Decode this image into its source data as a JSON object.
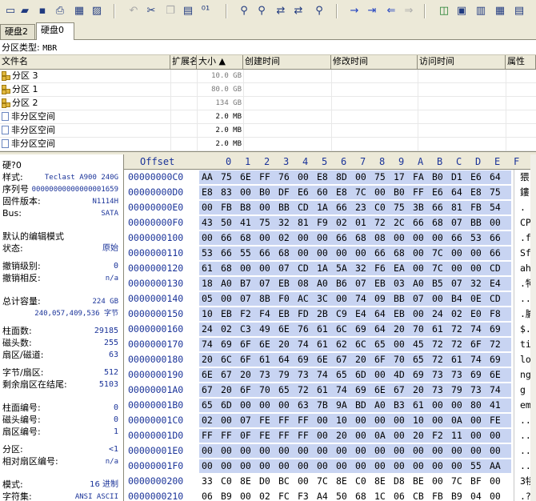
{
  "toolbar": {
    "icons": [
      "new-disk-icon",
      "open-folder-icon",
      "save-icon",
      "print-icon",
      "properties-icon",
      "open-image-icon",
      "undo-icon",
      "cut-icon",
      "copy-icon",
      "paste-icon",
      "binary-icon",
      "find-icon",
      "find-hex-icon",
      "replace-icon",
      "replace-hex-icon",
      "find-next-icon",
      "goto-icon",
      "goto-offset-icon",
      "back-icon",
      "forward-icon",
      "disk-icon",
      "windows-icon",
      "ram-icon",
      "calculator-icon",
      "settings-icon"
    ]
  },
  "tabs": [
    {
      "label": "硬盘2",
      "active": false
    },
    {
      "label": "硬盘0",
      "active": true
    }
  ],
  "partition_type": {
    "label": "分区类型:",
    "value": "MBR"
  },
  "columns": [
    {
      "label": "文件名"
    },
    {
      "label": "扩展名"
    },
    {
      "label": "大小 ▲"
    },
    {
      "label": "创建时间"
    },
    {
      "label": "修改时间"
    },
    {
      "label": "访问时间"
    },
    {
      "label": "属性"
    }
  ],
  "partitions": [
    {
      "name": "分区 3",
      "size": "10.0 GB",
      "icon": "tree"
    },
    {
      "name": "分区 1",
      "size": "80.0 GB",
      "icon": "tree"
    },
    {
      "name": "分区 2",
      "size": "134 GB",
      "icon": "tree"
    },
    {
      "name": "非分区空间",
      "size": "2.0 MB",
      "icon": "page"
    },
    {
      "name": "非分区空间",
      "size": "2.0 MB",
      "icon": "page"
    },
    {
      "name": "非分区空间",
      "size": "2.0 MB",
      "icon": "page"
    }
  ],
  "info": {
    "disk_title": "硬?0",
    "model_label": "样式:",
    "model": "Teclast A900 240G",
    "serial_label": "序列号",
    "serial": "00000000000000001659",
    "firmware_label": "固件版本:",
    "firmware": "N1114H",
    "bus_label": "Bus:",
    "bus": "SATA",
    "edit_mode_label": "默认的编辑模式",
    "state_label": "状态:",
    "state": "原始",
    "undo_level_label": "撤销级别:",
    "undo_level": "0",
    "undo_reverse_label": "撤销相反:",
    "undo_reverse": "n/a",
    "capacity_label": "总计容量:",
    "capacity": "224 GB",
    "capacity_bytes": "240,057,409,536 字节",
    "cylinders_label": "柱面数:",
    "cylinders": "29185",
    "heads_label": "磁头数:",
    "heads": "255",
    "sectors_track_label": "扇区/磁道:",
    "sectors_track": "63",
    "bytes_sector_label": "字节/扇区:",
    "bytes_sector": "512",
    "remaining_label": "剩余扇区在结尾:",
    "remaining": "5103",
    "cyl_no_label": "柱面编号:",
    "cyl_no": "0",
    "head_no_label": "磁头编号:",
    "head_no": "0",
    "sector_no_label": "扇区编号:",
    "sector_no": "1",
    "partition_label": "分区:",
    "partition": "<1",
    "rel_sector_label": "相对扇区编号:",
    "rel_sector": "n/a",
    "mode_label": "模式:",
    "mode": "16 进制",
    "charset_label": "字符集:",
    "charset": "ANSI ASCII"
  },
  "hex_header": {
    "offset_label": "Offset",
    "columns": [
      "0",
      "1",
      "2",
      "3",
      "4",
      "5",
      "6",
      "7",
      "8",
      "9",
      "A",
      "B",
      "C",
      "D",
      "E",
      "F"
    ]
  },
  "hex_rows": [
    {
      "offset": "00000000C0",
      "bytes": [
        "AA",
        "75",
        "6E",
        "FF",
        "76",
        "00",
        "E8",
        "8D",
        "00",
        "75",
        "17",
        "FA",
        "B0",
        "D1",
        "E6",
        "64"
      ],
      "ascii": "猥ｎ"
    },
    {
      "offset": "00000000D0",
      "bytes": [
        "E8",
        "83",
        "00",
        "B0",
        "DF",
        "E6",
        "60",
        "E8",
        "7C",
        "00",
        "B0",
        "FF",
        "E6",
        "64",
        "E8",
        "75"
      ],
      "ascii": "鏤."
    },
    {
      "offset": "00000000E0",
      "bytes": [
        "00",
        "FB",
        "B8",
        "00",
        "BB",
        "CD",
        "1A",
        "66",
        "23",
        "C0",
        "75",
        "3B",
        "66",
        "81",
        "FB",
        "54"
      ],
      "ascii": ". "
    },
    {
      "offset": "00000000F0",
      "bytes": [
        "43",
        "50",
        "41",
        "75",
        "32",
        "81",
        "F9",
        "02",
        "01",
        "72",
        "2C",
        "66",
        "68",
        "07",
        "BB",
        "00"
      ],
      "ascii": "CPA"
    },
    {
      "offset": "0000000100",
      "bytes": [
        "00",
        "66",
        "68",
        "00",
        "02",
        "00",
        "00",
        "66",
        "68",
        "08",
        "00",
        "00",
        "00",
        "66",
        "53",
        "66"
      ],
      "ascii": ".fh"
    },
    {
      "offset": "0000000110",
      "bytes": [
        "53",
        "66",
        "55",
        "66",
        "68",
        "00",
        "00",
        "00",
        "00",
        "66",
        "68",
        "00",
        "7C",
        "00",
        "00",
        "66"
      ],
      "ascii": "SfU"
    },
    {
      "offset": "0000000120",
      "bytes": [
        "61",
        "68",
        "00",
        "00",
        "07",
        "CD",
        "1A",
        "5A",
        "32",
        "F6",
        "EA",
        "00",
        "7C",
        "00",
        "00",
        "CD"
      ],
      "ascii": "ah."
    },
    {
      "offset": "0000000130",
      "bytes": [
        "18",
        "A0",
        "B7",
        "07",
        "EB",
        "08",
        "A0",
        "B6",
        "07",
        "EB",
        "03",
        "A0",
        "B5",
        "07",
        "32",
        "E4"
      ],
      "ascii": ".牱"
    },
    {
      "offset": "0000000140",
      "bytes": [
        "05",
        "00",
        "07",
        "8B",
        "F0",
        "AC",
        "3C",
        "00",
        "74",
        "09",
        "BB",
        "07",
        "00",
        "B4",
        "0E",
        "CD"
      ],
      "ascii": ".. "
    },
    {
      "offset": "0000000150",
      "bytes": [
        "10",
        "EB",
        "F2",
        "F4",
        "EB",
        "FD",
        "2B",
        "C9",
        "E4",
        "64",
        "EB",
        "00",
        "24",
        "02",
        "E0",
        "F8"
      ],
      "ascii": ".腧"
    },
    {
      "offset": "0000000160",
      "bytes": [
        "24",
        "02",
        "C3",
        "49",
        "6E",
        "76",
        "61",
        "6C",
        "69",
        "64",
        "20",
        "70",
        "61",
        "72",
        "74",
        "69"
      ],
      "ascii": "$.I"
    },
    {
      "offset": "0000000170",
      "bytes": [
        "74",
        "69",
        "6F",
        "6E",
        "20",
        "74",
        "61",
        "62",
        "6C",
        "65",
        "00",
        "45",
        "72",
        "72",
        "6F",
        "72"
      ],
      "ascii": "tio"
    },
    {
      "offset": "0000000180",
      "bytes": [
        "20",
        "6C",
        "6F",
        "61",
        "64",
        "69",
        "6E",
        "67",
        "20",
        "6F",
        "70",
        "65",
        "72",
        "61",
        "74",
        "69"
      ],
      "ascii": " lo"
    },
    {
      "offset": "0000000190",
      "bytes": [
        "6E",
        "67",
        "20",
        "73",
        "79",
        "73",
        "74",
        "65",
        "6D",
        "00",
        "4D",
        "69",
        "73",
        "73",
        "69",
        "6E"
      ],
      "ascii": "ng s"
    },
    {
      "offset": "00000001A0",
      "bytes": [
        "67",
        "20",
        "6F",
        "70",
        "65",
        "72",
        "61",
        "74",
        "69",
        "6E",
        "67",
        "20",
        "73",
        "79",
        "73",
        "74"
      ],
      "ascii": "g o"
    },
    {
      "offset": "00000001B0",
      "bytes": [
        "65",
        "6D",
        "00",
        "00",
        "00",
        "63",
        "7B",
        "9A",
        "BD",
        "A0",
        "B3",
        "61",
        "00",
        "00",
        "80",
        "41"
      ],
      "ascii": "em."
    },
    {
      "offset": "00000001C0",
      "bytes": [
        "02",
        "00",
        "07",
        "FE",
        "FF",
        "FF",
        "00",
        "10",
        "00",
        "00",
        "00",
        "10",
        "00",
        "0A",
        "00",
        "FE"
      ],
      "ascii": "..."
    },
    {
      "offset": "00000001D0",
      "bytes": [
        "FF",
        "FF",
        "0F",
        "FE",
        "FF",
        "FF",
        "00",
        "20",
        "00",
        "0A",
        "00",
        "20",
        "F2",
        "11",
        "00",
        "00"
      ],
      "ascii": "..."
    },
    {
      "offset": "00000001E0",
      "bytes": [
        "00",
        "00",
        "00",
        "00",
        "00",
        "00",
        "00",
        "00",
        "00",
        "00",
        "00",
        "00",
        "00",
        "00",
        "00",
        "00"
      ],
      "ascii": "..."
    },
    {
      "offset": "00000001F0",
      "bytes": [
        "00",
        "00",
        "00",
        "00",
        "00",
        "00",
        "00",
        "00",
        "00",
        "00",
        "00",
        "00",
        "00",
        "00",
        "55",
        "AA"
      ],
      "ascii": "..."
    },
    {
      "offset": "0000000200",
      "bytes": [
        "33",
        "C0",
        "8E",
        "D0",
        "BC",
        "00",
        "7C",
        "8E",
        "C0",
        "8E",
        "D8",
        "BE",
        "00",
        "7C",
        "BF",
        "00"
      ],
      "ascii": "3犊"
    },
    {
      "offset": "0000000210",
      "bytes": [
        "06",
        "B9",
        "00",
        "02",
        "FC",
        "F3",
        "A4",
        "50",
        "68",
        "1C",
        "06",
        "CB",
        "FB",
        "B9",
        "04",
        "00"
      ],
      "ascii": ".?."
    }
  ]
}
